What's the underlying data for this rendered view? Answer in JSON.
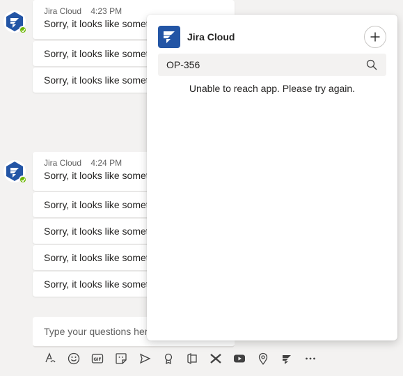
{
  "thread": [
    {
      "sender": "Jira Cloud",
      "time": "4:23 PM",
      "messages": [
        "Sorry, it looks like someth",
        "Sorry, it looks like someth",
        "Sorry, it looks like someth"
      ]
    },
    {
      "sender": "Jira Cloud",
      "time": "4:24 PM",
      "messages": [
        "Sorry, it looks like someth",
        "Sorry, it looks like someth",
        "Sorry, it looks like someth",
        "Sorry, it looks like someth",
        "Sorry, it looks like someth"
      ]
    }
  ],
  "compose": {
    "placeholder": "Type your questions here"
  },
  "toolbar": {
    "icons": [
      "format-icon",
      "emoji-icon",
      "gif-icon",
      "sticker-icon",
      "send-icon",
      "praise-icon",
      "stream-icon",
      "app-icon",
      "video-icon",
      "location-icon",
      "jira-icon",
      "more-icon"
    ]
  },
  "popup": {
    "title": "Jira Cloud",
    "search_value": "OP-356",
    "error_message": "Unable to reach app. Please try again."
  },
  "colors": {
    "jira_blue": "#2355a5",
    "presence_green": "#6bb700",
    "background": "#f3f2f1"
  }
}
